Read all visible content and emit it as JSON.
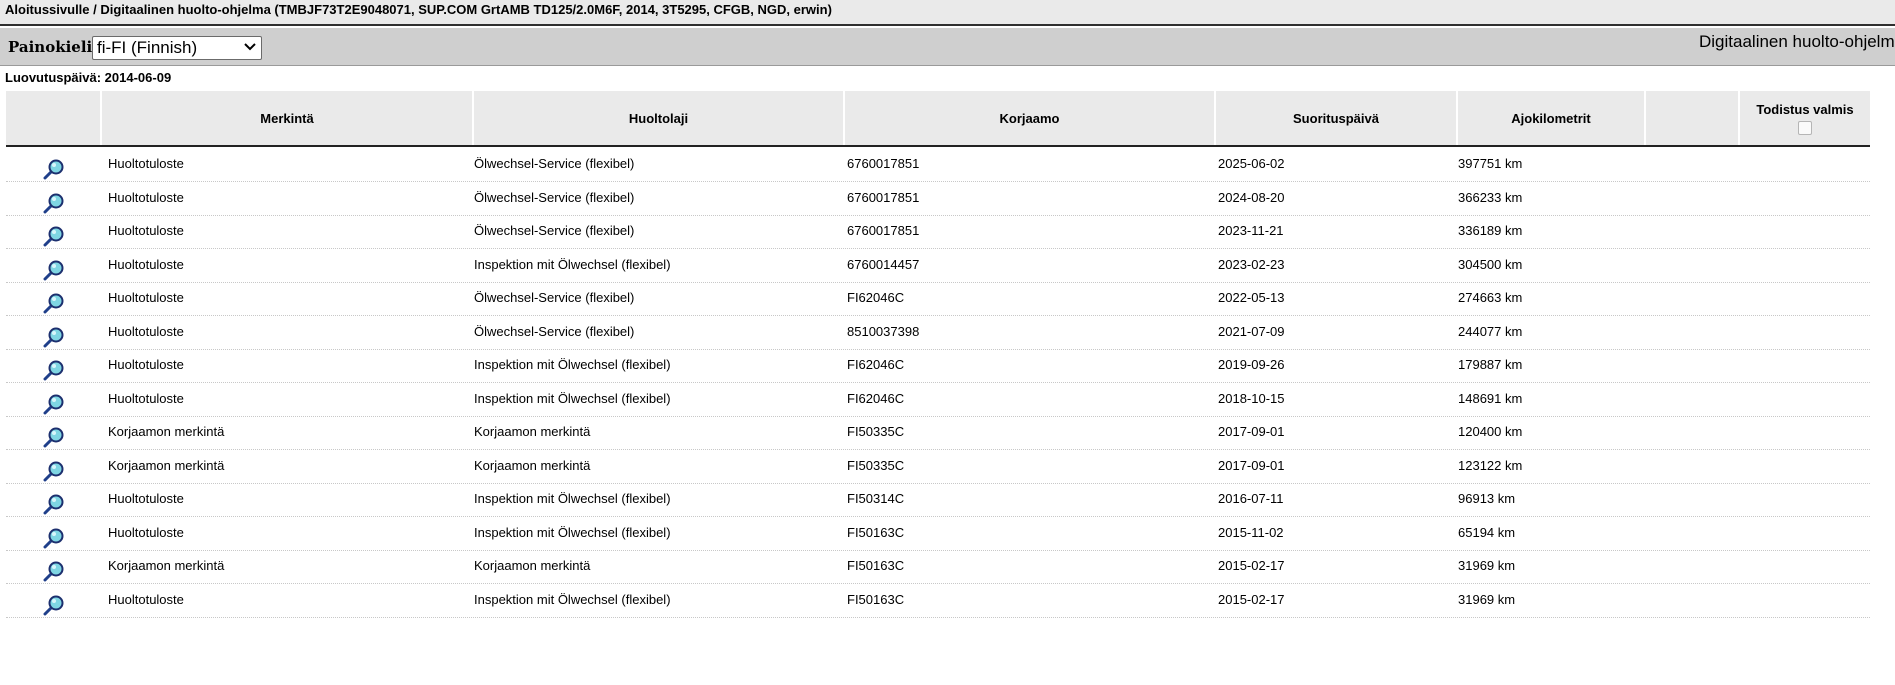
{
  "breadcrumb": "Aloitussivulle / Digitaalinen huolto-ohjelma (TMBJF73T2E9048071, SUP.COM GrtAMB TD125/2.0M6F, 2014, 3T5295, CFGB, NGD, erwin)",
  "toolbar": {
    "language_label": "Painokieli:",
    "language_value": "fi-FI (Finnish)",
    "program_title": "Digitaalinen huolto-ohjelma"
  },
  "delivery_date": "Luovutuspäivä: 2014-06-09",
  "table": {
    "headers": [
      "",
      "Merkintä",
      "Huoltolaji",
      "Korjaamo",
      "Suorituspäivä",
      "Ajokilometrit",
      "",
      "Todistus valmis"
    ],
    "rows": [
      {
        "merkinta": "Huoltotuloste",
        "huoltolaji": "Ölwechsel-Service (flexibel)",
        "korjaamo": "6760017851",
        "paiva": "2025-06-02",
        "km": "397751 km"
      },
      {
        "merkinta": "Huoltotuloste",
        "huoltolaji": "Ölwechsel-Service (flexibel)",
        "korjaamo": "6760017851",
        "paiva": "2024-08-20",
        "km": "366233 km"
      },
      {
        "merkinta": "Huoltotuloste",
        "huoltolaji": "Ölwechsel-Service (flexibel)",
        "korjaamo": "6760017851",
        "paiva": "2023-11-21",
        "km": "336189 km"
      },
      {
        "merkinta": "Huoltotuloste",
        "huoltolaji": "Inspektion mit Ölwechsel (flexibel)",
        "korjaamo": "6760014457",
        "paiva": "2023-02-23",
        "km": "304500 km"
      },
      {
        "merkinta": "Huoltotuloste",
        "huoltolaji": "Ölwechsel-Service (flexibel)",
        "korjaamo": "FI62046C",
        "paiva": "2022-05-13",
        "km": "274663 km"
      },
      {
        "merkinta": "Huoltotuloste",
        "huoltolaji": "Ölwechsel-Service (flexibel)",
        "korjaamo": "8510037398",
        "paiva": "2021-07-09",
        "km": "244077 km"
      },
      {
        "merkinta": "Huoltotuloste",
        "huoltolaji": "Inspektion mit Ölwechsel (flexibel)",
        "korjaamo": "FI62046C",
        "paiva": "2019-09-26",
        "km": "179887 km"
      },
      {
        "merkinta": "Huoltotuloste",
        "huoltolaji": "Inspektion mit Ölwechsel (flexibel)",
        "korjaamo": "FI62046C",
        "paiva": "2018-10-15",
        "km": "148691 km"
      },
      {
        "merkinta": "Korjaamon merkintä",
        "huoltolaji": "Korjaamon merkintä",
        "korjaamo": "FI50335C",
        "paiva": "2017-09-01",
        "km": "120400 km"
      },
      {
        "merkinta": "Korjaamon merkintä",
        "huoltolaji": "Korjaamon merkintä",
        "korjaamo": "FI50335C",
        "paiva": "2017-09-01",
        "km": "123122 km"
      },
      {
        "merkinta": "Huoltotuloste",
        "huoltolaji": "Inspektion mit Ölwechsel (flexibel)",
        "korjaamo": "FI50314C",
        "paiva": "2016-07-11",
        "km": "96913 km"
      },
      {
        "merkinta": "Huoltotuloste",
        "huoltolaji": "Inspektion mit Ölwechsel (flexibel)",
        "korjaamo": "FI50163C",
        "paiva": "2015-11-02",
        "km": "65194 km"
      },
      {
        "merkinta": "Korjaamon merkintä",
        "huoltolaji": "Korjaamon merkintä",
        "korjaamo": "FI50163C",
        "paiva": "2015-02-17",
        "km": "31969 km"
      },
      {
        "merkinta": "Huoltotuloste",
        "huoltolaji": "Inspektion mit Ölwechsel (flexibel)",
        "korjaamo": "FI50163C",
        "paiva": "2015-02-17",
        "km": "31969 km"
      }
    ]
  },
  "icons": {
    "row_view": "magnifier-icon",
    "language_dropdown": "chevron-down-icon"
  }
}
